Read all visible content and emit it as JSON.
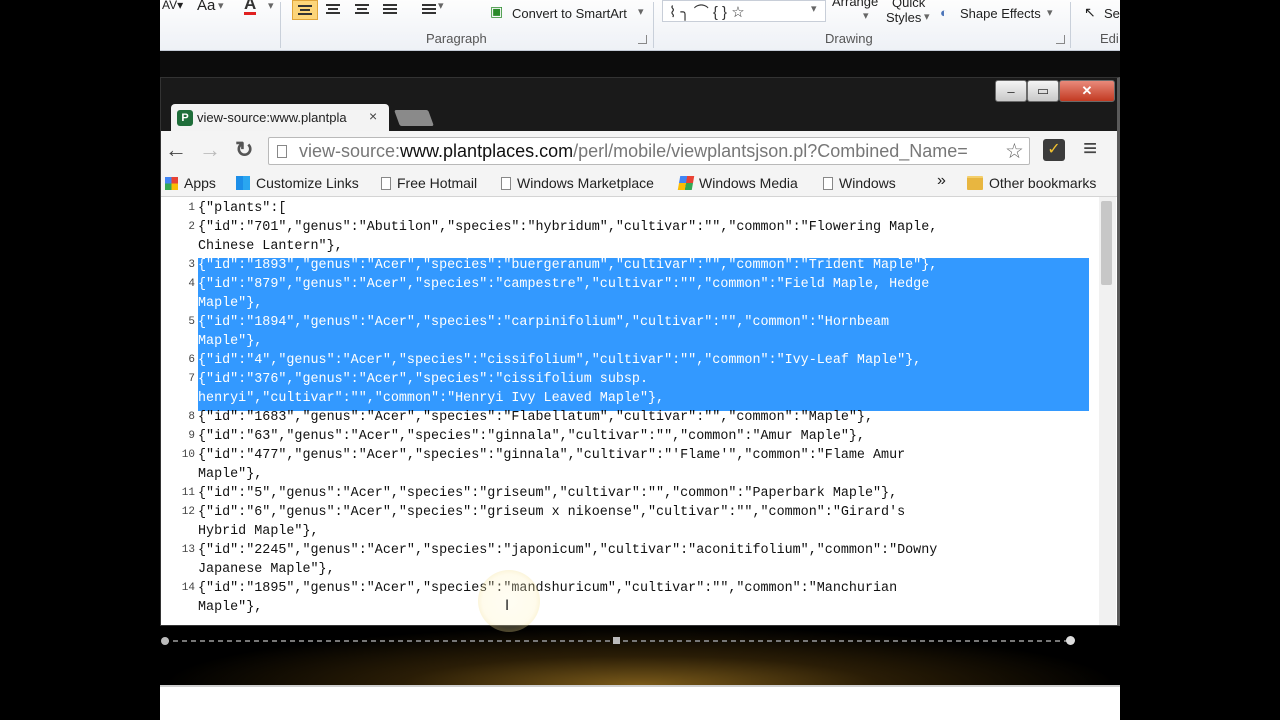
{
  "ribbon": {
    "paragraph_label": "Paragraph",
    "drawing_label": "Drawing",
    "editing_label": "Edi",
    "convert_smartart": "Convert to SmartArt",
    "arrange": "Arrange",
    "quick": "Quick",
    "styles": "Styles",
    "shape_effects": "Shape Effects",
    "select_stub": "Se",
    "font_size_icon": "Aa",
    "font_color_icon": "A",
    "shapes_glyphs": "⌇ ╮ ⌒ { } ☆"
  },
  "window": {
    "minimize": "‒",
    "maximize": "▭",
    "close": "✕"
  },
  "tab": {
    "title": "view-source:www.plantpla",
    "close": "×",
    "favicon": "P"
  },
  "nav": {
    "back": "←",
    "forward": "→",
    "reload": "↻",
    "url_prefix": "view-source:",
    "url_host": "www.plantplaces.com",
    "url_path": "/perl/mobile/viewplantsjson.pl?Combined_Name=",
    "star": "☆",
    "menu": "≡"
  },
  "bookmarks": {
    "items": [
      "Apps",
      "Customize Links",
      "Free Hotmail",
      "Windows Marketplace",
      "Windows Media",
      "Windows"
    ],
    "more": "»",
    "other": "Other bookmarks"
  },
  "source": {
    "rows": [
      {
        "n": "1",
        "text": "{\"plants\":[",
        "sel": false
      },
      {
        "n": "2",
        "text": "{\"id\":\"701\",\"genus\":\"Abutilon\",\"species\":\"hybridum\",\"cultivar\":\"\",\"common\":\"Flowering Maple,",
        "sel": false
      },
      {
        "n": "",
        "text": "Chinese Lantern\"},",
        "sel": false
      },
      {
        "n": "3",
        "text": "{\"id\":\"1893\",\"genus\":\"Acer\",\"species\":\"buergeranum\",\"cultivar\":\"\",\"common\":\"Trident Maple\"},",
        "sel": true
      },
      {
        "n": "4",
        "text": "{\"id\":\"879\",\"genus\":\"Acer\",\"species\":\"campestre\",\"cultivar\":\"\",\"common\":\"Field Maple, Hedge",
        "sel": true
      },
      {
        "n": "",
        "text": "Maple\"},",
        "sel": true
      },
      {
        "n": "5",
        "text": "{\"id\":\"1894\",\"genus\":\"Acer\",\"species\":\"carpinifolium\",\"cultivar\":\"\",\"common\":\"Hornbeam",
        "sel": true
      },
      {
        "n": "",
        "text": "Maple\"},",
        "sel": true
      },
      {
        "n": "6",
        "text": "{\"id\":\"4\",\"genus\":\"Acer\",\"species\":\"cissifolium\",\"cultivar\":\"\",\"common\":\"Ivy-Leaf Maple\"},",
        "sel": true
      },
      {
        "n": "7",
        "text": "{\"id\":\"376\",\"genus\":\"Acer\",\"species\":\"cissifolium subsp.",
        "sel": true
      },
      {
        "n": "",
        "text": "henryi\",\"cultivar\":\"\",\"common\":\"Henryi Ivy Leaved Maple\"},",
        "sel": true
      },
      {
        "n": "8",
        "text": "{\"id\":\"1683\",\"genus\":\"Acer\",\"species\":\"Flabellatum\",\"cultivar\":\"\",\"common\":\"Maple\"},",
        "sel": false
      },
      {
        "n": "9",
        "text": "{\"id\":\"63\",\"genus\":\"Acer\",\"species\":\"ginnala\",\"cultivar\":\"\",\"common\":\"Amur Maple\"},",
        "sel": false
      },
      {
        "n": "10",
        "text": "{\"id\":\"477\",\"genus\":\"Acer\",\"species\":\"ginnala\",\"cultivar\":\"'Flame'\",\"common\":\"Flame Amur",
        "sel": false
      },
      {
        "n": "",
        "text": "Maple\"},",
        "sel": false
      },
      {
        "n": "11",
        "text": "{\"id\":\"5\",\"genus\":\"Acer\",\"species\":\"griseum\",\"cultivar\":\"\",\"common\":\"Paperbark Maple\"},",
        "sel": false
      },
      {
        "n": "12",
        "text": "{\"id\":\"6\",\"genus\":\"Acer\",\"species\":\"griseum x nikoense\",\"cultivar\":\"\",\"common\":\"Girard's",
        "sel": false
      },
      {
        "n": "",
        "text": "Hybrid Maple\"},",
        "sel": false
      },
      {
        "n": "13",
        "text": "{\"id\":\"2245\",\"genus\":\"Acer\",\"species\":\"japonicum\",\"cultivar\":\"aconitifolium\",\"common\":\"Downy",
        "sel": false
      },
      {
        "n": "",
        "text": "Japanese Maple\"},",
        "sel": false
      },
      {
        "n": "14",
        "text": "{\"id\":\"1895\",\"genus\":\"Acer\",\"species\":\"mandshuricum\",\"cultivar\":\"\",\"common\":\"Manchurian",
        "sel": false
      },
      {
        "n": "",
        "text": "Maple\"},",
        "sel": false
      }
    ]
  },
  "colors": {
    "selection": "#3399ff",
    "ribbon_align_active": "#fcd57a"
  },
  "icons": [
    "apps-grid-icon",
    "windows-logo-icon",
    "page-icon",
    "folder-icon",
    "reload-icon",
    "star-icon",
    "extension-icon",
    "menu-icon"
  ]
}
